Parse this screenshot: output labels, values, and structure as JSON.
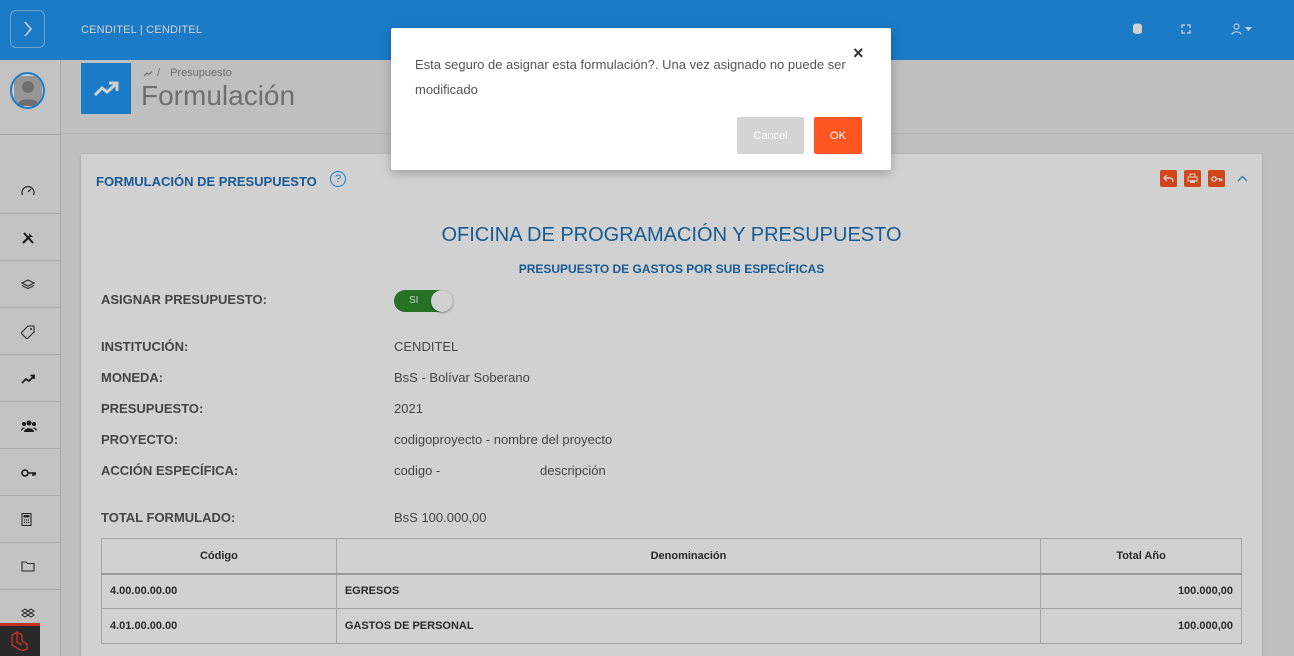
{
  "header": {
    "brand": "CENDITEL | CENDITEL",
    "icons": [
      "menu-toggle-icon",
      "database-icon",
      "fullscreen-icon",
      "user-icon",
      "caret-down-icon"
    ]
  },
  "sidebar": {
    "items": [
      "dashboard-icon",
      "tools-icon",
      "layers-icon",
      "tag-icon",
      "trending-up-icon",
      "users-icon",
      "key-icon",
      "calculator-icon",
      "folder-icon",
      "dropbox-icon"
    ]
  },
  "breadcrumb": {
    "items": [
      "Presupuesto"
    ]
  },
  "page": {
    "title": "Formulación"
  },
  "card": {
    "title": "FORMULACIÓN DE PRESUPUESTO",
    "help_symbol": "?",
    "tool_icons": [
      "undo-icon",
      "print-icon",
      "key-icon",
      "chevron-up-icon"
    ]
  },
  "report": {
    "org": "OFICINA DE PROGRAMACIÓN Y PRESUPUESTO",
    "subtitle": "PRESUPUESTO DE GASTOS POR SUB ESPECÍFICAS",
    "assign_label": "ASIGNAR PRESUPUESTO:",
    "assign_toggle": "SI",
    "fields": [
      {
        "label": "INSTITUCIÓN:",
        "value": "CENDITEL"
      },
      {
        "label": "MONEDA:",
        "value": "BsS - Bolívar Soberano"
      },
      {
        "label": "PRESUPUESTO:",
        "value": "2021"
      },
      {
        "label": "PROYECTO:",
        "value": "codigoproyecto - nombre del proyecto"
      },
      {
        "label": "ACCIÓN ESPECÍFICA:",
        "value": "codigo -",
        "value2": "descripción"
      }
    ],
    "total_label": "TOTAL FORMULADO:",
    "total_value": "BsS  100.000,00",
    "table": {
      "headers": [
        "Código",
        "Denominación",
        "Total Año"
      ],
      "rows": [
        [
          "4.00.00.00.00",
          "EGRESOS",
          "100.000,00"
        ],
        [
          "4.01.00.00.00",
          "GASTOS DE PERSONAL",
          "100.000,00"
        ]
      ]
    }
  },
  "modal": {
    "message": "Esta seguro de asignar esta formulación?. Una vez asignado no puede ser modificado",
    "close_symbol": "×",
    "cancel_label": "Cancel",
    "ok_label": "OK"
  },
  "colors": {
    "primary": "#2196f3",
    "accent": "#ff5722",
    "switch_on": "#2e8b2e",
    "title_blue": "#1e6fb5"
  }
}
